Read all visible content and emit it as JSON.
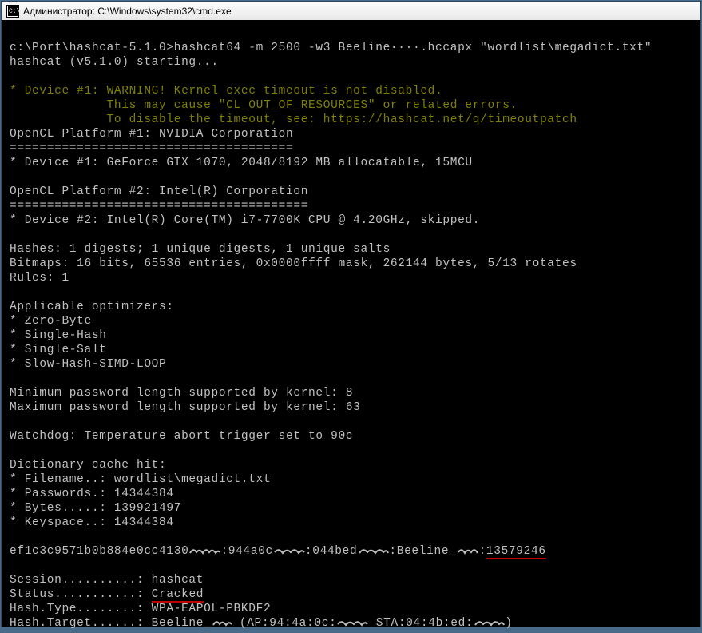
{
  "window": {
    "title": "Администратор: C:\\Windows\\system32\\cmd.exe"
  },
  "term": {
    "blank": "",
    "cmd_line": "c:\\Port\\hashcat-5.1.0>hashcat64 -m 2500 -w3 Beeline····.hccapx \"wordlist\\megadict.txt\"",
    "start": "hashcat (v5.1.0) starting...",
    "warn1": "* Device #1: WARNING! Kernel exec timeout is not disabled.",
    "warn2": "             This may cause \"CL_OUT_OF_RESOURCES\" or related errors.",
    "warn3": "             To disable the timeout, see: https://hashcat.net/q/timeoutpatch",
    "plat1": "OpenCL Platform #1: NVIDIA Corporation",
    "sep1": "======================================",
    "dev1": "* Device #1: GeForce GTX 1070, 2048/8192 MB allocatable, 15MCU",
    "plat2": "OpenCL Platform #2: Intel(R) Corporation",
    "sep2": "========================================",
    "dev2": "* Device #2: Intel(R) Core(TM) i7-7700K CPU @ 4.20GHz, skipped.",
    "hashes": "Hashes: 1 digests; 1 unique digests, 1 unique salts",
    "bitmaps": "Bitmaps: 16 bits, 65536 entries, 0x0000ffff mask, 262144 bytes, 5/13 rotates",
    "rules": "Rules: 1",
    "opt_h": "Applicable optimizers:",
    "opt1": "* Zero-Byte",
    "opt2": "* Single-Hash",
    "opt3": "* Single-Salt",
    "opt4": "* Slow-Hash-SIMD-LOOP",
    "min_pw": "Minimum password length supported by kernel: 8",
    "max_pw": "Maximum password length supported by kernel: 63",
    "watchdog": "Watchdog: Temperature abort trigger set to 90c",
    "dict_h": "Dictionary cache hit:",
    "dict_fn": "* Filename..: wordlist\\megadict.txt",
    "dict_pw": "* Passwords.: 14344384",
    "dict_by": "* Bytes.....: 139921497",
    "dict_ks": "* Keyspace..: 14344384",
    "crack_a": "ef1c3c9571b0b884e0cc4130",
    "crack_b": ":944a0c",
    "crack_c": ":044bed",
    "crack_d": ":Beeline_",
    "crack_e": ":",
    "crack_pass": "13579246",
    "sess": "Session..........: hashcat",
    "stat_l": "Status...........: ",
    "stat_v": "Cracked",
    "htype": "Hash.Type........: WPA-EAPOL-PBKDF2",
    "htgt_a": "Hash.Target......: Beeline_",
    "htgt_b": " (AP:94:4a:0c:",
    "htgt_c": " STA:04:4b:ed:",
    "htgt_d": ")"
  }
}
